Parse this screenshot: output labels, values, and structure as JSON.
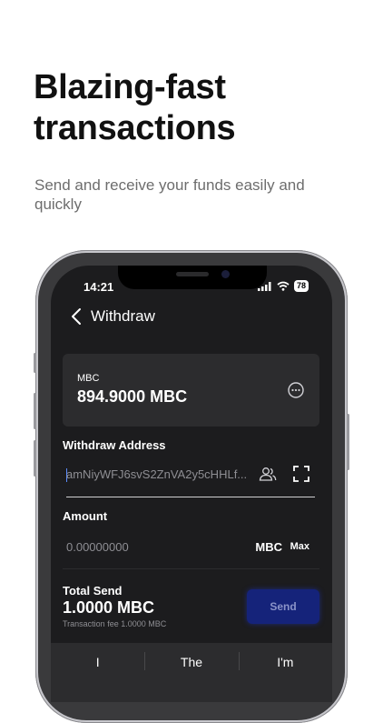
{
  "promo": {
    "headline_line1": "Blazing-fast",
    "headline_line2": "transactions",
    "subtitle": "Send and receive your funds easily and quickly"
  },
  "status_bar": {
    "time": "14:21",
    "battery": "78"
  },
  "header": {
    "title": "Withdraw"
  },
  "balance_card": {
    "currency_label": "MBC",
    "balance": "894.9000 MBC"
  },
  "withdraw_address": {
    "label": "Withdraw Address",
    "value": "amNiyWFJ6svS2ZnVA2y5cHHLf..."
  },
  "amount": {
    "label": "Amount",
    "placeholder": "0.00000000",
    "unit": "MBC",
    "max_label": "Max"
  },
  "summary": {
    "total_label": "Total Send",
    "total_value": "1.0000 MBC",
    "fee_text": "Transaction fee 1.0000 MBC",
    "send_label": "Send"
  },
  "keyboard": {
    "suggestions": [
      "I",
      "The",
      "I'm"
    ]
  },
  "colors": {
    "screen_bg": "#1c1c1e",
    "card_bg": "#2c2c2e",
    "send_button": "#15237a"
  }
}
